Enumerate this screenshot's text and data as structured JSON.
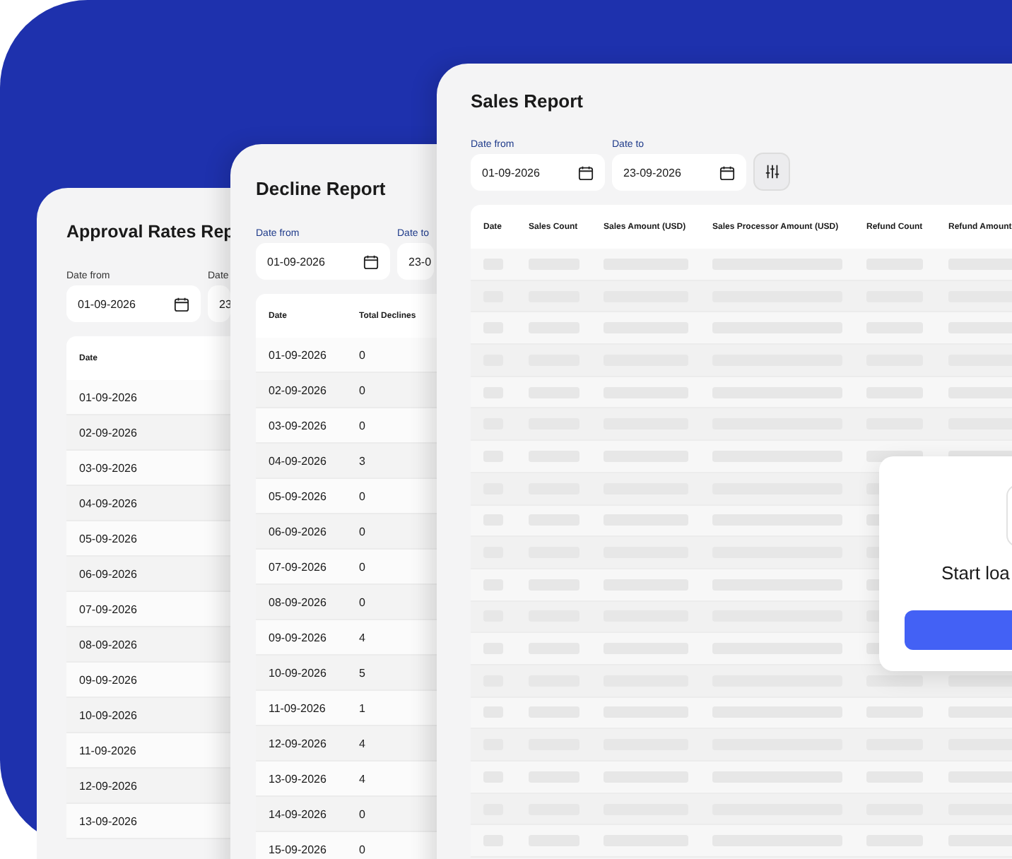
{
  "approval_report": {
    "title": "Approval Rates Rep",
    "date_from": {
      "label": "Date from",
      "value": "01-09-2026"
    },
    "date_to": {
      "label": "Date",
      "value": "23"
    },
    "columns": [
      "Date"
    ],
    "rows": [
      "01-09-2026",
      "02-09-2026",
      "03-09-2026",
      "04-09-2026",
      "05-09-2026",
      "06-09-2026",
      "07-09-2026",
      "08-09-2026",
      "09-09-2026",
      "10-09-2026",
      "11-09-2026",
      "12-09-2026",
      "13-09-2026"
    ]
  },
  "decline_report": {
    "title": "Decline Report",
    "date_from": {
      "label": "Date from",
      "value": "01-09-2026"
    },
    "date_to": {
      "label": "Date to",
      "value": "23-0"
    },
    "columns": [
      "Date",
      "Total Declines"
    ],
    "rows": [
      {
        "date": "01-09-2026",
        "total": "0"
      },
      {
        "date": "02-09-2026",
        "total": "0"
      },
      {
        "date": "03-09-2026",
        "total": "0"
      },
      {
        "date": "04-09-2026",
        "total": "3"
      },
      {
        "date": "05-09-2026",
        "total": "0"
      },
      {
        "date": "06-09-2026",
        "total": "0"
      },
      {
        "date": "07-09-2026",
        "total": "0"
      },
      {
        "date": "08-09-2026",
        "total": "0"
      },
      {
        "date": "09-09-2026",
        "total": "4"
      },
      {
        "date": "10-09-2026",
        "total": "5"
      },
      {
        "date": "11-09-2026",
        "total": "1"
      },
      {
        "date": "12-09-2026",
        "total": "4"
      },
      {
        "date": "13-09-2026",
        "total": "4"
      },
      {
        "date": "14-09-2026",
        "total": "0"
      },
      {
        "date": "15-09-2026",
        "total": "0"
      }
    ]
  },
  "sales_report": {
    "title": "Sales Report",
    "date_from": {
      "label": "Date from",
      "value": "01-09-2026"
    },
    "date_to": {
      "label": "Date to",
      "value": "23-09-2026"
    },
    "columns": [
      "Date",
      "Sales Count",
      "Sales Amount (USD)",
      "Sales Processor Amount (USD)",
      "Refund Count",
      "Refund Amount"
    ]
  },
  "loading_dialog": {
    "text": "Start loa"
  }
}
